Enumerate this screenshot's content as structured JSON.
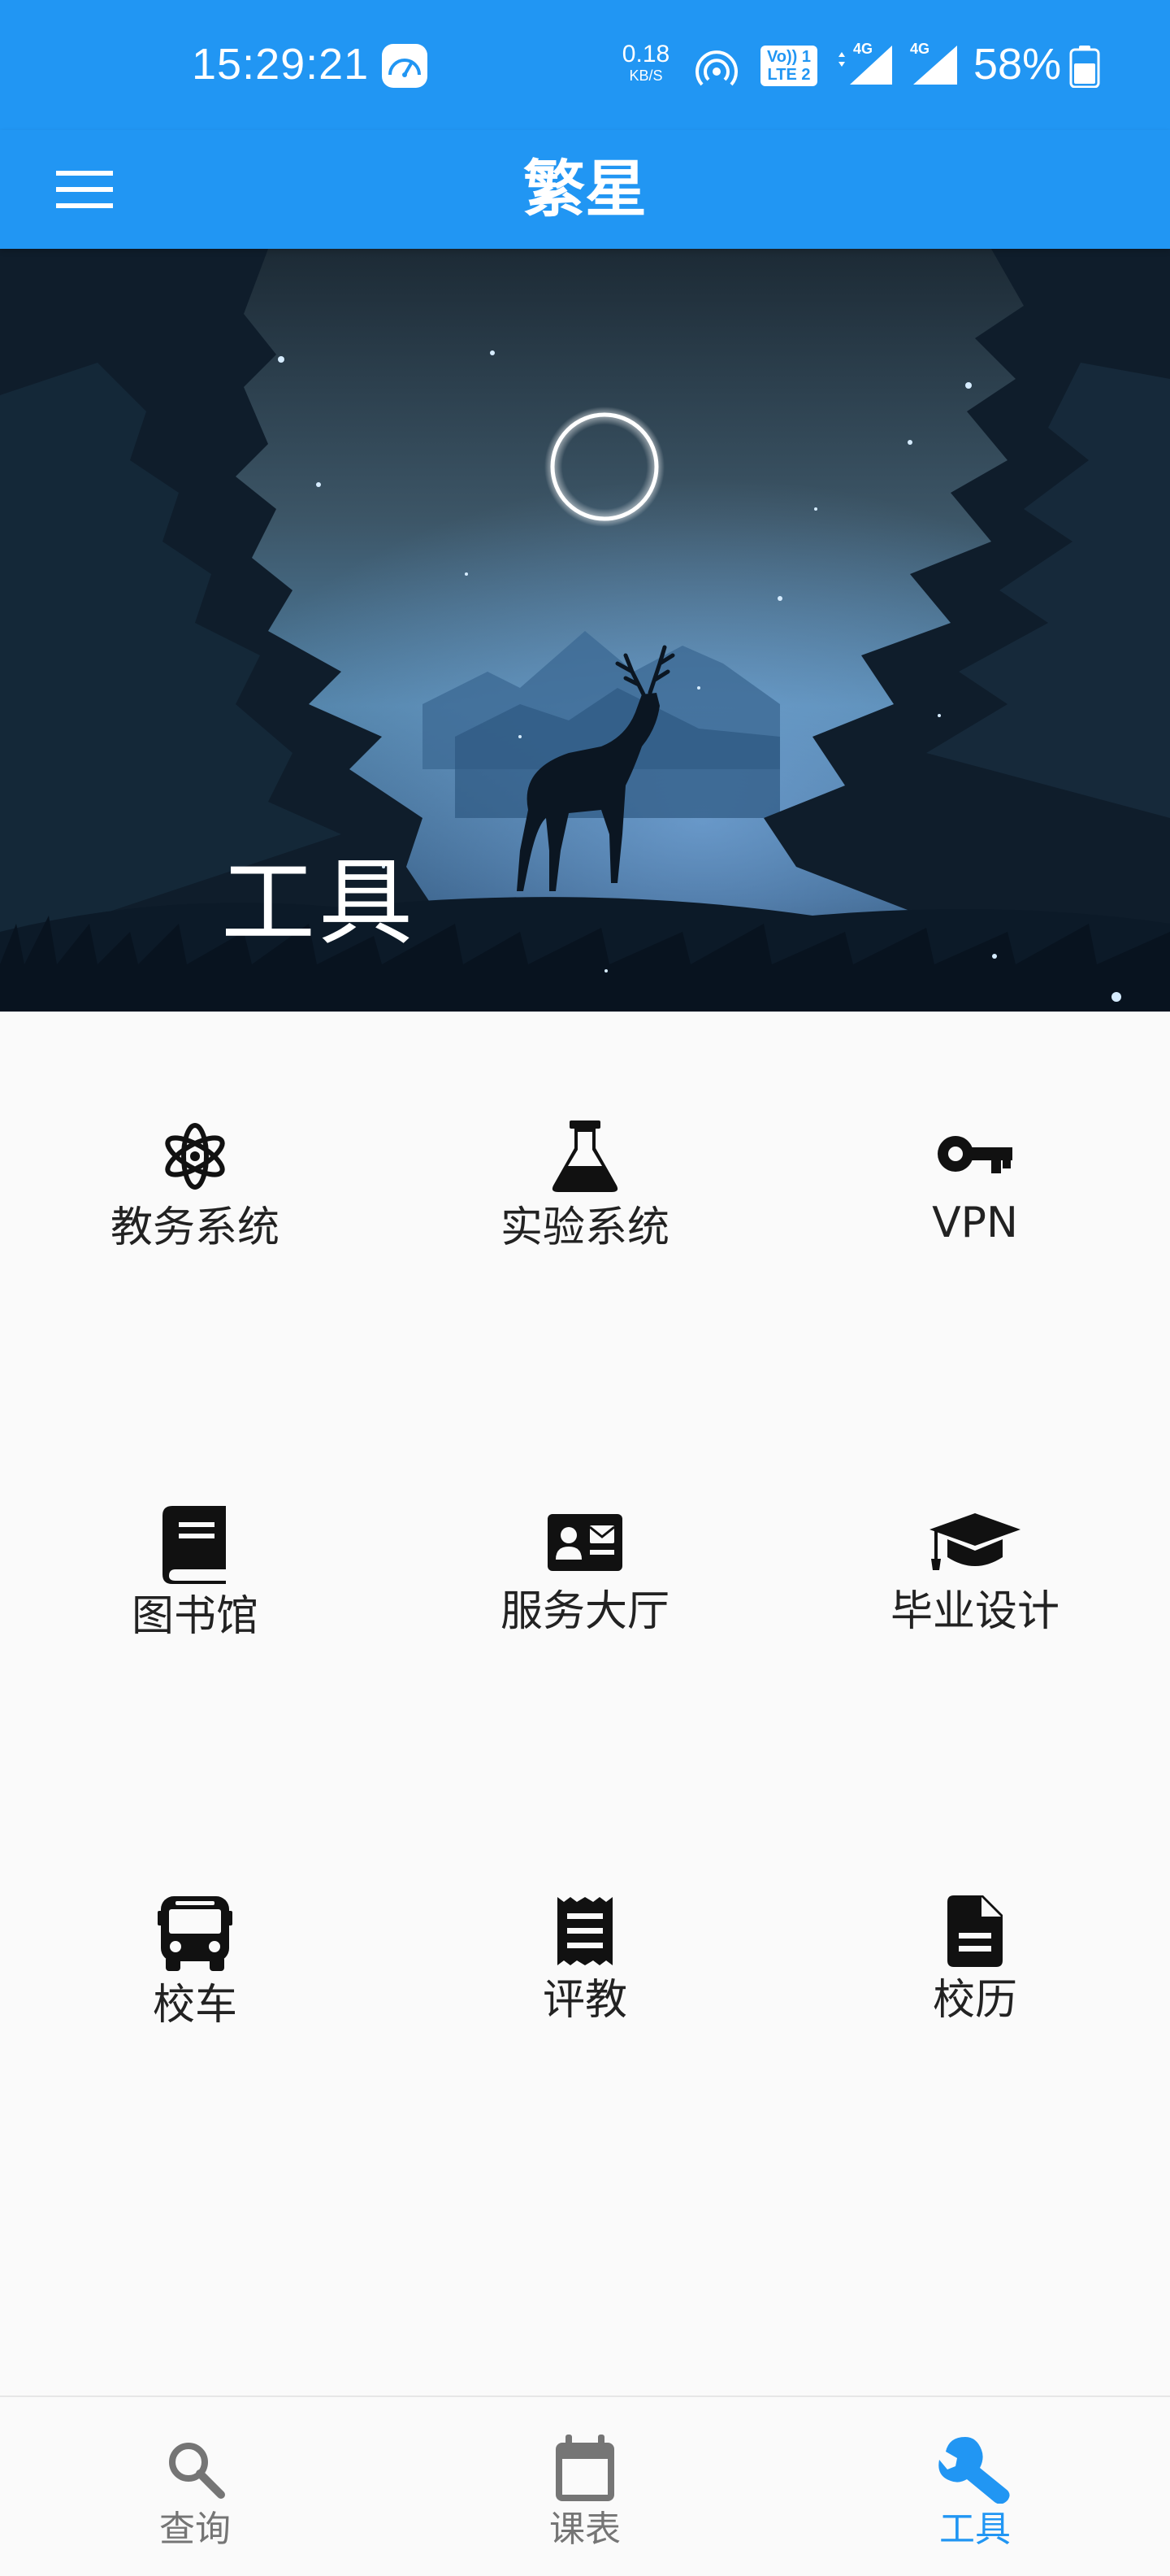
{
  "colors": {
    "primary": "#2196f3",
    "background": "#fafafa",
    "text": "#222222",
    "nav_inactive": "#757575"
  },
  "status_bar": {
    "time": "15:29:21",
    "net_speed": "0.18",
    "net_unit": "KB/S",
    "volte_line1": "Vo)) 1",
    "volte_line2": "LTE 2",
    "sig1_label": "4G",
    "sig2_label": "4G",
    "battery": "58%"
  },
  "app_bar": {
    "title": "繁星",
    "menu_icon": "menu-icon"
  },
  "hero": {
    "title": "工具"
  },
  "tools": [
    {
      "label": "教务系统",
      "icon": "atom-icon"
    },
    {
      "label": "实验系统",
      "icon": "flask-icon"
    },
    {
      "label": "VPN",
      "icon": "key-icon"
    },
    {
      "label": "图书馆",
      "icon": "book-icon"
    },
    {
      "label": "服务大厅",
      "icon": "contact-card-icon"
    },
    {
      "label": "毕业设计",
      "icon": "graduation-cap-icon"
    },
    {
      "label": "校车",
      "icon": "bus-icon"
    },
    {
      "label": "评教",
      "icon": "receipt-icon"
    },
    {
      "label": "校历",
      "icon": "document-icon"
    }
  ],
  "bottom_nav": {
    "items": [
      {
        "label": "查询",
        "icon": "search-icon",
        "active": false
      },
      {
        "label": "课表",
        "icon": "calendar-icon",
        "active": false
      },
      {
        "label": "工具",
        "icon": "wrench-icon",
        "active": true
      }
    ]
  }
}
